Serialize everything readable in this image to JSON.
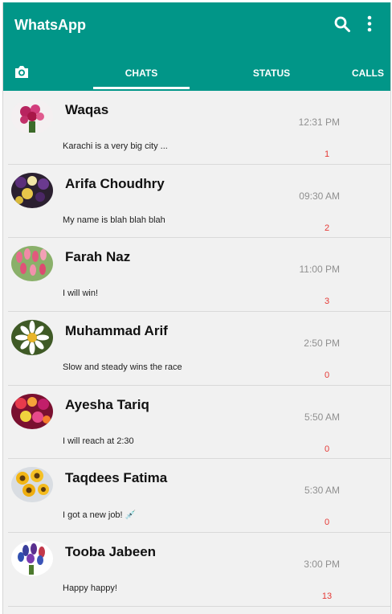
{
  "header": {
    "title": "WhatsApp",
    "search_icon": "search-icon",
    "menu_icon": "more-vertical-icon",
    "camera_icon": "camera-icon",
    "color": "#019688"
  },
  "tabs": [
    {
      "label": "CHATS",
      "active": true
    },
    {
      "label": "STATUS",
      "active": false
    },
    {
      "label": "CALLS",
      "active": false
    }
  ],
  "chats": [
    {
      "name": "Waqas",
      "message": "Karachi is a very big city ...",
      "time": "12:31 PM",
      "unread": "1"
    },
    {
      "name": "Arifa Choudhry",
      "message": "My name is blah blah blah",
      "time": "09:30 AM",
      "unread": "2"
    },
    {
      "name": "Farah Naz",
      "message": "I will win!",
      "time": "11:00 PM",
      "unread": "3"
    },
    {
      "name": "Muhammad Arif",
      "message": "Slow and steady wins the race",
      "time": "2:50 PM",
      "unread": "0"
    },
    {
      "name": "Ayesha Tariq",
      "message": "I will reach at 2:30",
      "time": "5:50 AM",
      "unread": "0"
    },
    {
      "name": "Taqdees Fatima",
      "message": "I got a new job! 💉",
      "time": "5:30 AM",
      "unread": "0"
    },
    {
      "name": "Tooba Jabeen",
      "message": "Happy happy!",
      "time": "3:00 PM",
      "unread": "13"
    }
  ]
}
